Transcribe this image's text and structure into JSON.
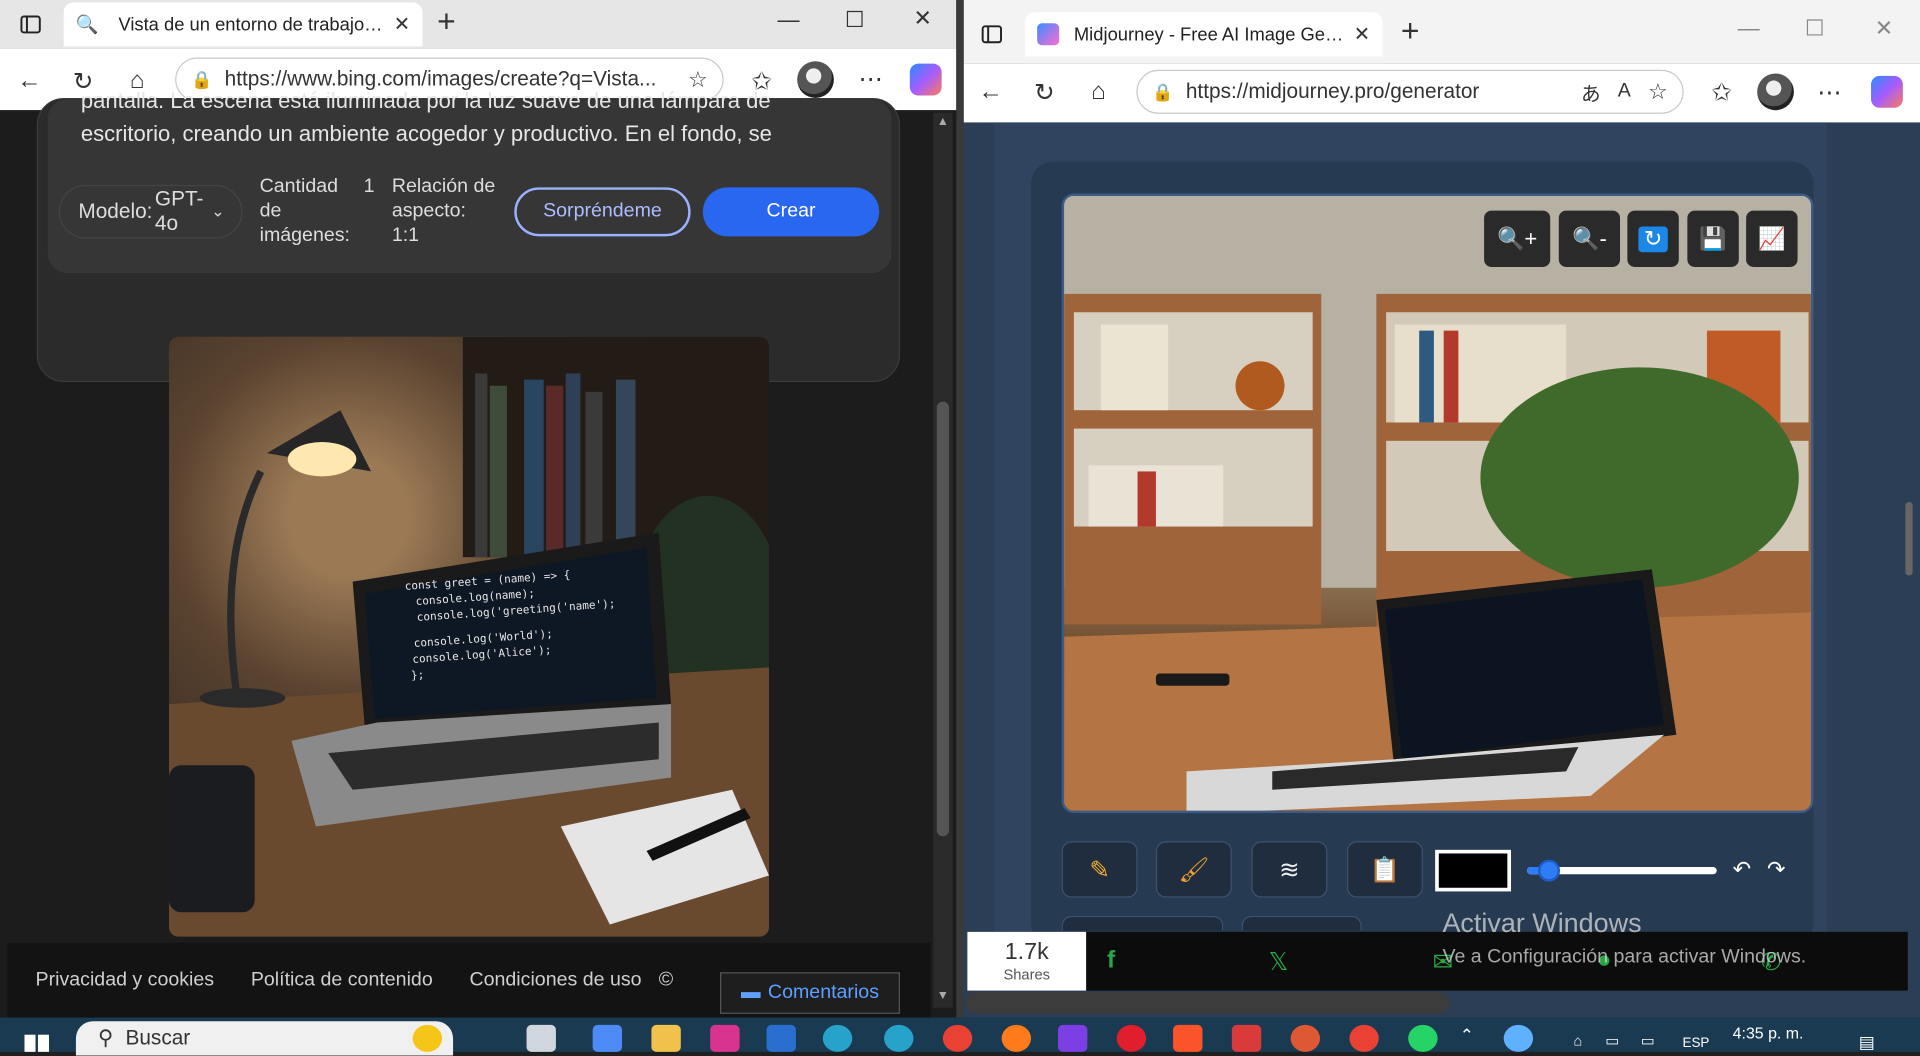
{
  "left_browser": {
    "tab_title": "Vista de un entorno de trabajo moderno",
    "tab_close": "✕",
    "url": "https://www.bing.com/images/create?q=Vista...",
    "prompt_text": "pantalla. La escena está iluminada por la luz suave de una lámpara de escritorio, creando un ambiente acogedor y productivo. En el fondo, se",
    "model_label": "Modelo:",
    "model_value": "GPT-4o",
    "quantity_label": "Cantidad de imágenes:",
    "quantity_value": "1",
    "aspect_label": "Relación de aspecto:",
    "aspect_value": "1:1",
    "surprise_button": "Sorpréndeme",
    "create_button": "Crear",
    "footer_links": [
      "Privacidad y cookies",
      "Política de contenido",
      "Condiciones de uso"
    ],
    "footer_copyright": "©",
    "comments_button": "Comentarios",
    "code_lines": [
      "const greet = (name) => {",
      "console.log(name);",
      "console.log('greeting('name');",
      "console.log('World');",
      "console.log('Alice');",
      "};"
    ]
  },
  "right_browser": {
    "tab_title": "Midjourney - Free AI Image Generator",
    "url": "https://midjourney.pro/generator",
    "zoom_in": "🔍+",
    "zoom_out": "🔍-",
    "share_count": "1.7k",
    "share_label": "Shares",
    "x_icon_text": "𝕏"
  },
  "watermark": {
    "title": "Activar Windows",
    "subtitle": "Ve a Configuración para activar Windows."
  },
  "taskbar": {
    "search_placeholder": "Buscar",
    "lang": "ESP",
    "time": "4:35 p. m."
  }
}
